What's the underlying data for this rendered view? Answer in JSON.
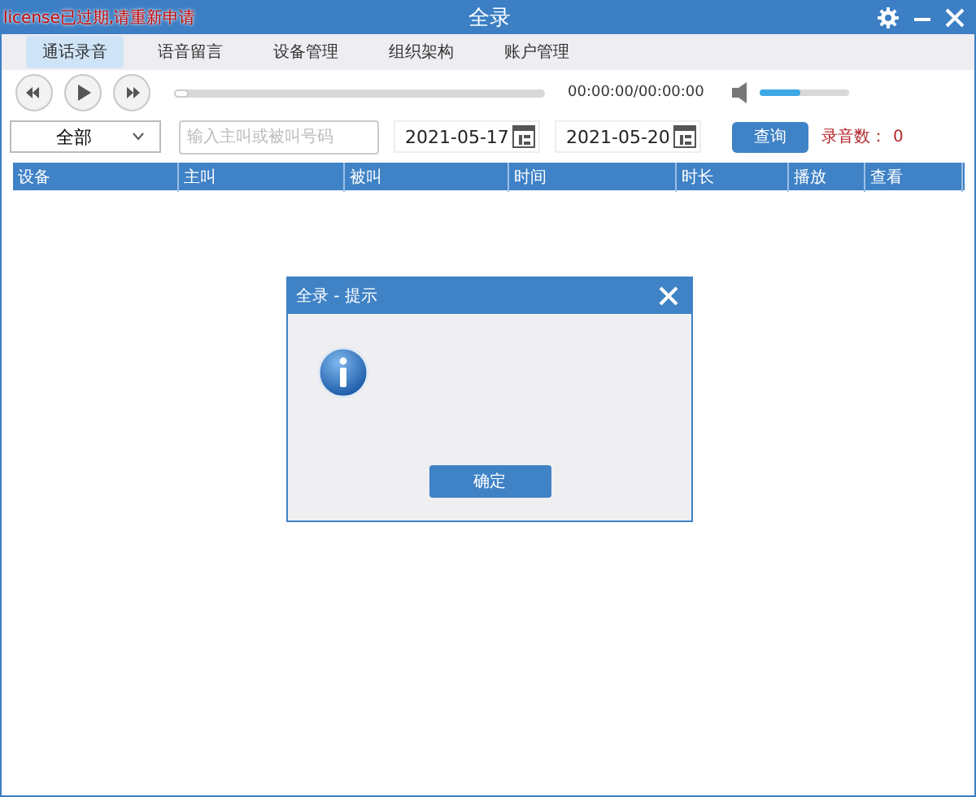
{
  "window": {
    "title": "全录",
    "notice": "license已过期,请重新申请"
  },
  "tabs": [
    {
      "label": "通话录音",
      "selected": true
    },
    {
      "label": "语音留言",
      "selected": false
    },
    {
      "label": "设备管理",
      "selected": false
    },
    {
      "label": "组织架构",
      "selected": false
    },
    {
      "label": "账户管理",
      "selected": false
    }
  ],
  "player": {
    "progress": {
      "level": 0.0
    },
    "time": "00:00:00/00:00:00",
    "volume": {
      "level": 0.45
    }
  },
  "filters": {
    "device": "全部",
    "search": {
      "placeholder": "输入主叫或被叫号码"
    },
    "start_date": "2021-05-17",
    "end_date": "2021-05-20",
    "query_button": "查询",
    "count_label": "录音数：",
    "count": "0"
  },
  "table": {
    "columns": [
      "设备",
      "主叫",
      "被叫",
      "时间",
      "时长",
      "播放",
      "查看"
    ]
  },
  "dialog": {
    "title": "全录 - 提示",
    "ok_button": "确定"
  }
}
